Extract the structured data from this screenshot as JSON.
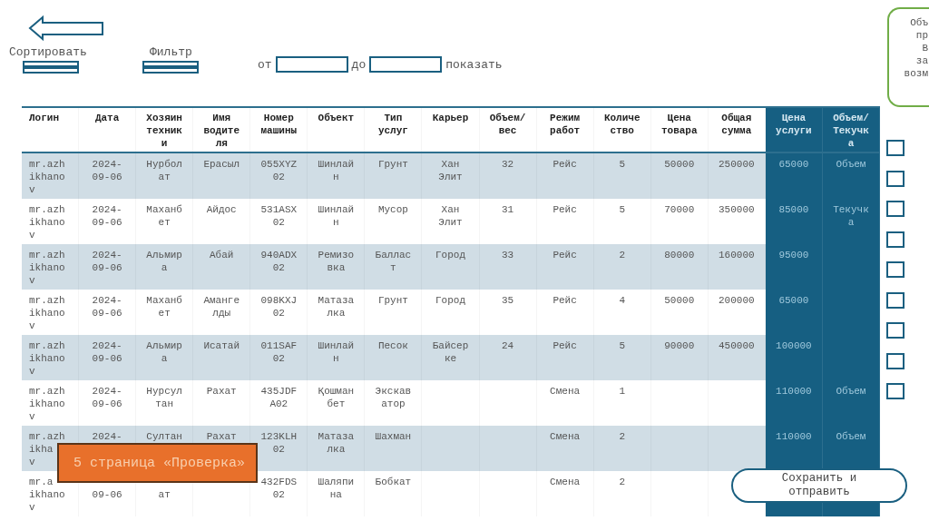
{
  "toolbar": {
    "sort_label": "Сортировать",
    "filter_label": "Фильтр",
    "range": {
      "from_label": "от",
      "to_label": "до",
      "show_label": "показать"
    }
  },
  "note": {
    "lines": [
      "Объ",
      "пр",
      "В",
      "за",
      "возм"
    ]
  },
  "table": {
    "columns": [
      {
        "label": "Логин",
        "highlighted": false
      },
      {
        "label": "Дата",
        "highlighted": false
      },
      {
        "label": "Хозяин\nтехник\nи",
        "highlighted": false
      },
      {
        "label": "Имя\nводите\nля",
        "highlighted": false
      },
      {
        "label": "Номер\nмашины",
        "highlighted": false
      },
      {
        "label": "Объект",
        "highlighted": false
      },
      {
        "label": "Тип\nуслуг",
        "highlighted": false
      },
      {
        "label": "Карьер",
        "highlighted": false
      },
      {
        "label": "Объем/\nвес",
        "highlighted": false
      },
      {
        "label": "Режим\nработ",
        "highlighted": false
      },
      {
        "label": "Количе\nство",
        "highlighted": false
      },
      {
        "label": "Цена\nтовара",
        "highlighted": false
      },
      {
        "label": "Общая\nсумма",
        "highlighted": false
      },
      {
        "label": "Цена\nуслуги",
        "highlighted": true
      },
      {
        "label": "Объем/\nТекучк\nа",
        "highlighted": true
      }
    ],
    "rows": [
      {
        "cells": [
          "mr.azh\nikhano\nv",
          "2024-\n09-06",
          "Нурбол\nат",
          "Ерасыл",
          "055XYZ\n02",
          "Шинлай\nн",
          "Грунт",
          "Хан\nЭлит",
          "32",
          "Рейс",
          "5",
          "50000",
          "250000",
          "65000",
          "Объем"
        ]
      },
      {
        "cells": [
          "mr.azh\nikhano\nv",
          "2024-\n09-06",
          "Маханб\nет",
          "Айдос",
          "531ASX\n02",
          "Шинлай\nн",
          "Мусор",
          "Хан\nЭлит",
          "31",
          "Рейс",
          "5",
          "70000",
          "350000",
          "85000",
          "Текучк\nа"
        ]
      },
      {
        "cells": [
          "mr.azh\nikhano\nv",
          "2024-\n09-06",
          "Альмир\nа",
          "Абай",
          "940ADX\n02",
          "Ремизо\nвка",
          "Баллас\nт",
          "Город",
          "33",
          "Рейс",
          "2",
          "80000",
          "160000",
          "95000",
          null
        ]
      },
      {
        "cells": [
          "mr.azh\nikhano\nv",
          "2024-\n09-06",
          "Маханб\nет",
          "Аманге\nлды",
          "098KXJ\n02",
          "Матаза\nлка",
          "Грунт",
          "Город",
          "35",
          "Рейс",
          "4",
          "50000",
          "200000",
          "65000",
          null
        ]
      },
      {
        "cells": [
          "mr.azh\nikhano\nv",
          "2024-\n09-06",
          "Альмир\nа",
          "Исатай",
          "011SAF\n02",
          "Шинлай\nн",
          "Песок",
          "Байсер\nке",
          "24",
          "Рейс",
          "5",
          "90000",
          "450000",
          "100000",
          null
        ]
      },
      {
        "cells": [
          "mr.azh\nikhano\nv",
          "2024-\n09-06",
          "Нурсул\nтан",
          "Рахат",
          "435JDF\nA02",
          "Қошман\nбет",
          "Экскав\nатор",
          null,
          null,
          "Смена",
          "1",
          null,
          null,
          "110000",
          "Объем"
        ]
      },
      {
        "cells": [
          "mr.azh\nikha\nv",
          "2024-",
          "Султан",
          "Рахат",
          "123KLH\n02",
          "Матаза\nлка",
          "Шахман",
          null,
          null,
          "Смена",
          "2",
          null,
          null,
          "110000",
          "Объем"
        ]
      },
      {
        "cells": [
          "mr.a\nikhano\nv",
          "\n09-06",
          "\nат",
          null,
          "432FDS\n02",
          "Шаляпи\nна",
          "Бобкат",
          null,
          null,
          "Смена",
          "2",
          null,
          null,
          null,
          null
        ]
      }
    ]
  },
  "checkboxes": [
    {
      "checked": false
    },
    {
      "checked": false
    },
    {
      "checked": false
    },
    {
      "checked": false
    },
    {
      "checked": false
    },
    {
      "checked": false
    },
    {
      "checked": false
    },
    {
      "checked": false
    },
    {
      "checked": false
    }
  ],
  "page_label": "5 страница «Проверка»",
  "save_button": "Сохранить и отправить"
}
